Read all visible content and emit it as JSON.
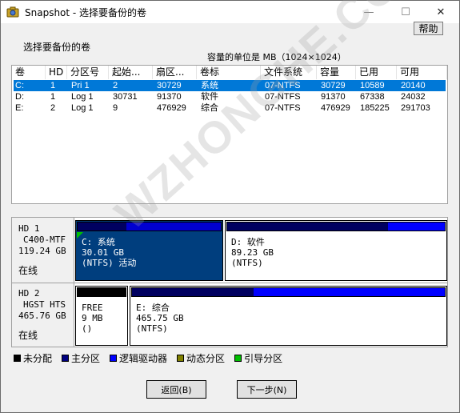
{
  "window": {
    "title": "Snapshot - 选择要备份的卷",
    "minimize": "—",
    "maximize": "☐",
    "close": "✕",
    "icon": "camera-icon"
  },
  "help_label": "帮助",
  "prompt": "选择要备份的卷",
  "capacity_note": "容量的单位是 MB（1024×1024）",
  "table": {
    "columns": [
      "卷",
      "HD",
      "分区号",
      "起始...",
      "扇区...",
      "卷标",
      "文件系统",
      "容量",
      "已用",
      "可用"
    ],
    "rows": [
      [
        "C:",
        "1",
        "Pri  1",
        "2",
        "30729",
        "系统",
        "07-NTFS",
        "30729",
        "10589",
        "20140"
      ],
      [
        "D:",
        "1",
        "Log  1",
        "30731",
        "91370",
        "软件",
        "07-NTFS",
        "91370",
        "67338",
        "24032"
      ],
      [
        "E:",
        "2",
        "Log  1",
        "9",
        "476929",
        "综合",
        "07-NTFS",
        "476929",
        "185225",
        "291703"
      ]
    ],
    "selected_row": 0
  },
  "disks": [
    {
      "name": "HD  1",
      "model": "C400-MTF",
      "size": "119.24 GB",
      "status": "在线",
      "partitions": [
        {
          "label": "C: 系统",
          "size": "30.01 GB",
          "fs": "(NTFS) 活动",
          "bar_color": "#0000d0",
          "used_fraction": 0.34,
          "selected": true,
          "boot": true
        },
        {
          "label": "D: 软件",
          "size": "89.23 GB",
          "fs": "(NTFS)",
          "bar_color": "#0000ff",
          "used_fraction": 0.74,
          "selected": false,
          "boot": false
        }
      ]
    },
    {
      "name": "HD  2",
      "model": "HGST HTS",
      "size": "465.76 GB",
      "status": "在线",
      "partitions": [
        {
          "label": "FREE",
          "size": "9 MB",
          "fs": "()",
          "bar_color": "#000000",
          "used_fraction": 0,
          "selected": false,
          "boot": false
        },
        {
          "label": "E: 综合",
          "size": "465.75 GB",
          "fs": "(NTFS)",
          "bar_color": "#0000ff",
          "used_fraction": 0.39,
          "selected": false,
          "boot": false
        }
      ]
    }
  ],
  "legend": [
    {
      "label": "未分配",
      "color": "#000000"
    },
    {
      "label": "主分区",
      "color": "#000080"
    },
    {
      "label": "逻辑驱动器",
      "color": "#0000ff"
    },
    {
      "label": "动态分区",
      "color": "#808000"
    },
    {
      "label": "引导分区",
      "color": "#00c000"
    }
  ],
  "buttons": {
    "back": "返回(B)",
    "next": "下一步(N)"
  },
  "watermark": "WZHONGHE.COM"
}
